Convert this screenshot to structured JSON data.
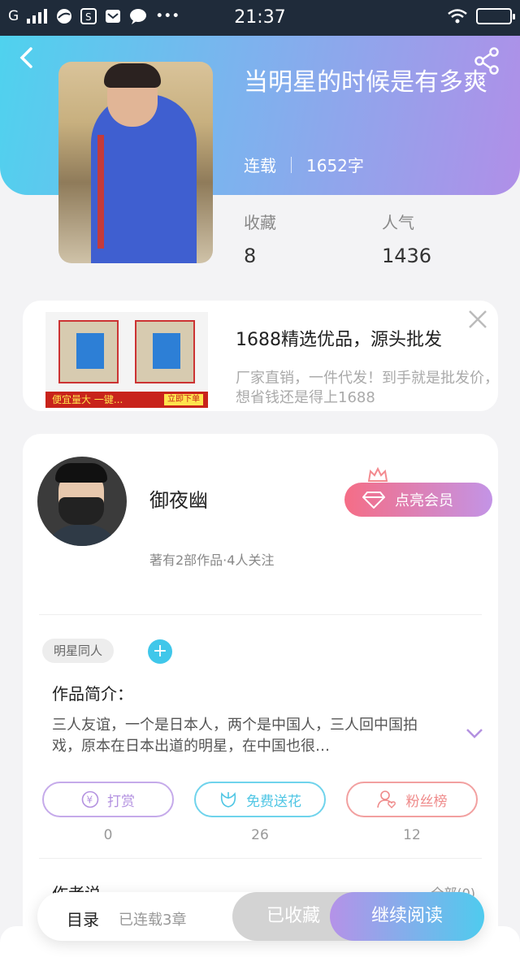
{
  "status_bar": {
    "carrier": "G",
    "time": "21:37"
  },
  "book": {
    "title": "当明星的时候是有多爽",
    "status": "连载",
    "word_count": "1652字",
    "stats": [
      {
        "label": "收藏",
        "value": "8"
      },
      {
        "label": "人气",
        "value": "1436"
      }
    ]
  },
  "ad": {
    "banner_left": "便宜量大 一键...",
    "banner_right": "立即下单",
    "title": "1688精选优品，源头批发",
    "description": "厂家直销，一件代发！到手就是批发价，想省钱还是得上1688"
  },
  "author": {
    "name": "御夜幽",
    "info": "著有2部作品·4人关注",
    "vip_button": "点亮会员"
  },
  "tags": [
    "明星同人"
  ],
  "intro": {
    "heading": "作品简介：",
    "text": "三人友谊，一个是日本人，两个是中国人，三人回中国拍戏，原本在日本出道的明星，在中国也很…"
  },
  "actions": [
    {
      "label": "打赏",
      "count": "0",
      "color": "#b391e0"
    },
    {
      "label": "免费送花",
      "count": "26",
      "color": "#4fc6e4"
    },
    {
      "label": "粉丝榜",
      "count": "12",
      "color": "#ef8a8a"
    }
  ],
  "author_say": {
    "label": "作者说",
    "link": "全部(0)"
  },
  "bottom_bar": {
    "toc": "目录",
    "toc_sub": "已连载3章",
    "collected": "已收藏",
    "read": "继续阅读"
  }
}
